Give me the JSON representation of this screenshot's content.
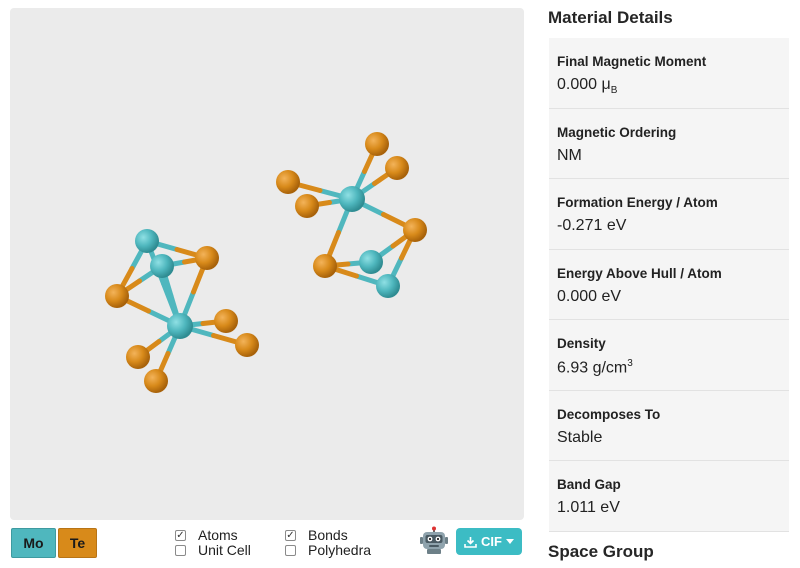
{
  "viewer": {
    "elements": [
      {
        "symbol": "Mo",
        "color": "#4fb7be"
      },
      {
        "symbol": "Te",
        "color": "#d88a1a"
      }
    ],
    "toggles": {
      "atoms": {
        "label": "Atoms",
        "checked": true
      },
      "unit_cell": {
        "label": "Unit Cell",
        "checked": false
      },
      "bonds": {
        "label": "Bonds",
        "checked": true
      },
      "polyhedra": {
        "label": "Polyhedra",
        "checked": false
      }
    },
    "download_label": "CIF"
  },
  "details": {
    "title": "Material Details",
    "properties": [
      {
        "label": "Final Magnetic Moment",
        "value": "0.000",
        "unit_main": "μ",
        "unit_sub": "B",
        "unit_sup": ""
      },
      {
        "label": "Magnetic Ordering",
        "value": "NM",
        "unit_main": "",
        "unit_sub": "",
        "unit_sup": ""
      },
      {
        "label": "Formation Energy / Atom",
        "value": "-0.271",
        "unit_main": "eV",
        "unit_sub": "",
        "unit_sup": ""
      },
      {
        "label": "Energy Above Hull / Atom",
        "value": "0.000",
        "unit_main": "eV",
        "unit_sub": "",
        "unit_sup": ""
      },
      {
        "label": "Density",
        "value": "6.93",
        "unit_main": "g/cm",
        "unit_sub": "",
        "unit_sup": "3"
      },
      {
        "label": "Decomposes To",
        "value": "Stable",
        "unit_main": "",
        "unit_sub": "",
        "unit_sup": ""
      },
      {
        "label": "Band Gap",
        "value": "1.011",
        "unit_main": "eV",
        "unit_sub": "",
        "unit_sup": ""
      }
    ],
    "next_section": "Space Group"
  }
}
